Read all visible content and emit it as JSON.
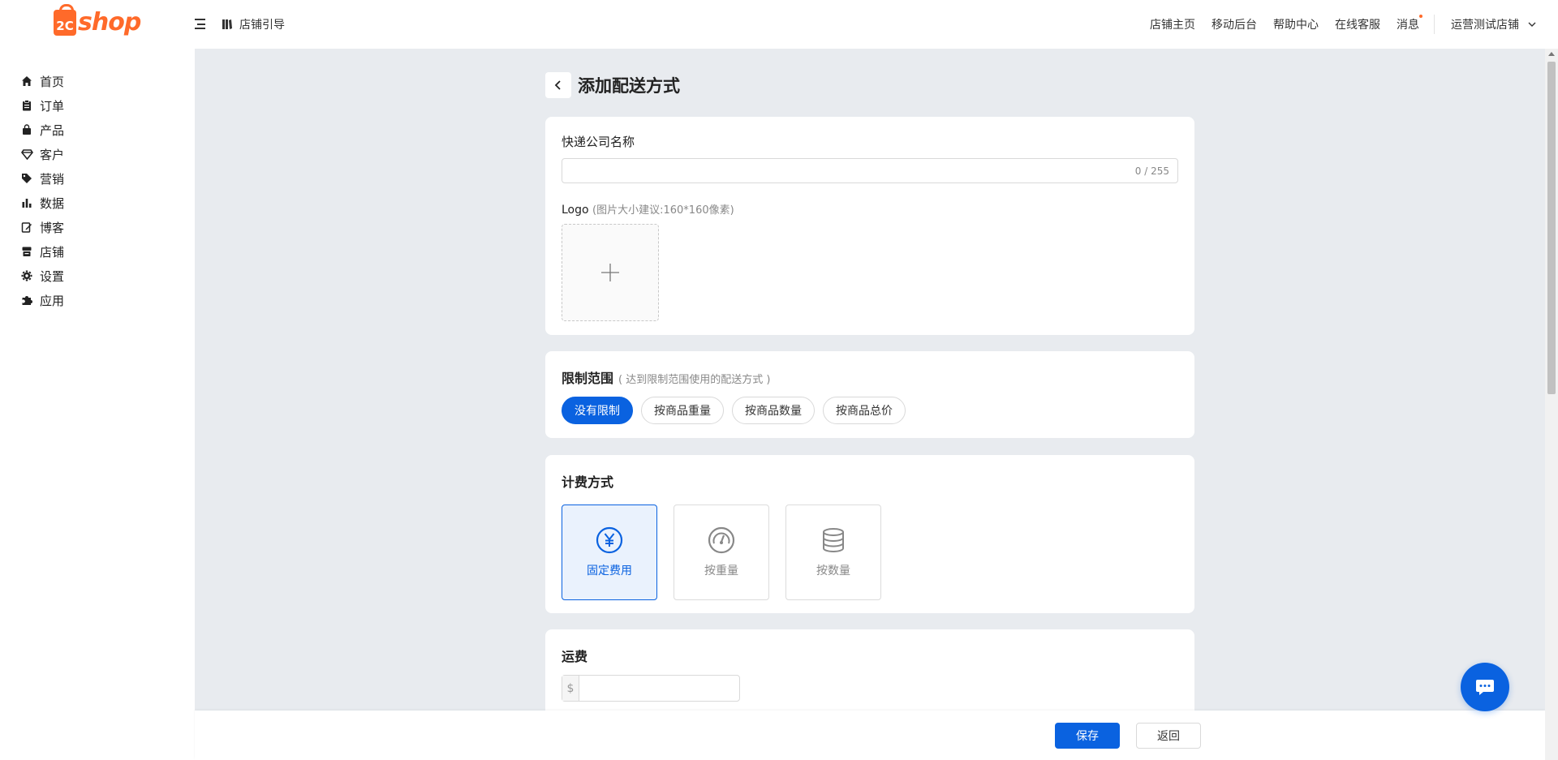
{
  "header": {
    "logo_prefix": "2C",
    "logo_text": "shop",
    "guide_label": "店铺引导",
    "nav": [
      "店铺主页",
      "移动后台",
      "帮助中心",
      "在线客服",
      "消息"
    ],
    "store_name": "运营测试店铺"
  },
  "sidebar": {
    "items": [
      {
        "label": "首页",
        "icon": "home-icon"
      },
      {
        "label": "订单",
        "icon": "clipboard-icon"
      },
      {
        "label": "产品",
        "icon": "bag-icon"
      },
      {
        "label": "客户",
        "icon": "diamond-icon"
      },
      {
        "label": "营销",
        "icon": "tag-icon"
      },
      {
        "label": "数据",
        "icon": "bar-chart-icon"
      },
      {
        "label": "博客",
        "icon": "edit-icon"
      },
      {
        "label": "店铺",
        "icon": "store-icon"
      },
      {
        "label": "设置",
        "icon": "gear-icon"
      },
      {
        "label": "应用",
        "icon": "puzzle-icon"
      }
    ]
  },
  "page": {
    "title": "添加配送方式"
  },
  "company": {
    "label": "快递公司名称",
    "value": "",
    "counter": "0 / 255",
    "logo_label": "Logo",
    "logo_hint": "(图片大小建议:160*160像素)"
  },
  "scope": {
    "title": "限制范围",
    "subtitle": "( 达到限制范围使用的配送方式 )",
    "options": [
      "没有限制",
      "按商品重量",
      "按商品数量",
      "按商品总价"
    ],
    "selected": "没有限制"
  },
  "billing": {
    "title": "计费方式",
    "options": [
      {
        "label": "固定费用",
        "icon": "yen-icon"
      },
      {
        "label": "按重量",
        "icon": "gauge-icon"
      },
      {
        "label": "按数量",
        "icon": "database-icon"
      }
    ],
    "selected": "固定费用"
  },
  "fee": {
    "title": "运费",
    "currency": "$",
    "value": ""
  },
  "footer": {
    "save_label": "保存",
    "back_label": "返回"
  },
  "colors": {
    "primary": "#0a62e0",
    "brand": "#ff6a2a",
    "background": "#e8ebef"
  }
}
